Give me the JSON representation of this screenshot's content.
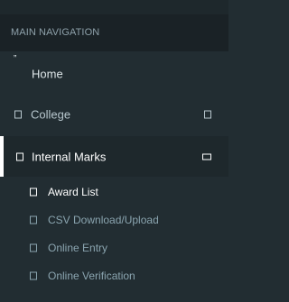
{
  "sidebar": {
    "header": "MAIN NAVIGATION",
    "items": [
      {
        "label": "Home",
        "icon": "quote-icon",
        "glyph": "”"
      },
      {
        "label": "College",
        "icon": "square-icon",
        "right_icon": "square-icon"
      },
      {
        "label": "Internal Marks",
        "icon": "square-icon",
        "right_icon": "minus-square-icon",
        "active": true
      }
    ],
    "subitems": [
      {
        "label": "Award List",
        "icon": "square-icon",
        "highlight": true
      },
      {
        "label": "CSV Download/Upload",
        "icon": "square-icon"
      },
      {
        "label": "Online Entry",
        "icon": "square-icon"
      },
      {
        "label": "Online Verification",
        "icon": "square-icon"
      }
    ]
  },
  "colors": {
    "sidebar_bg": "#222d32",
    "header_bg": "#1a2226",
    "active_bg": "#1e282c",
    "text": "#b8c7ce",
    "active_text": "#ffffff"
  }
}
